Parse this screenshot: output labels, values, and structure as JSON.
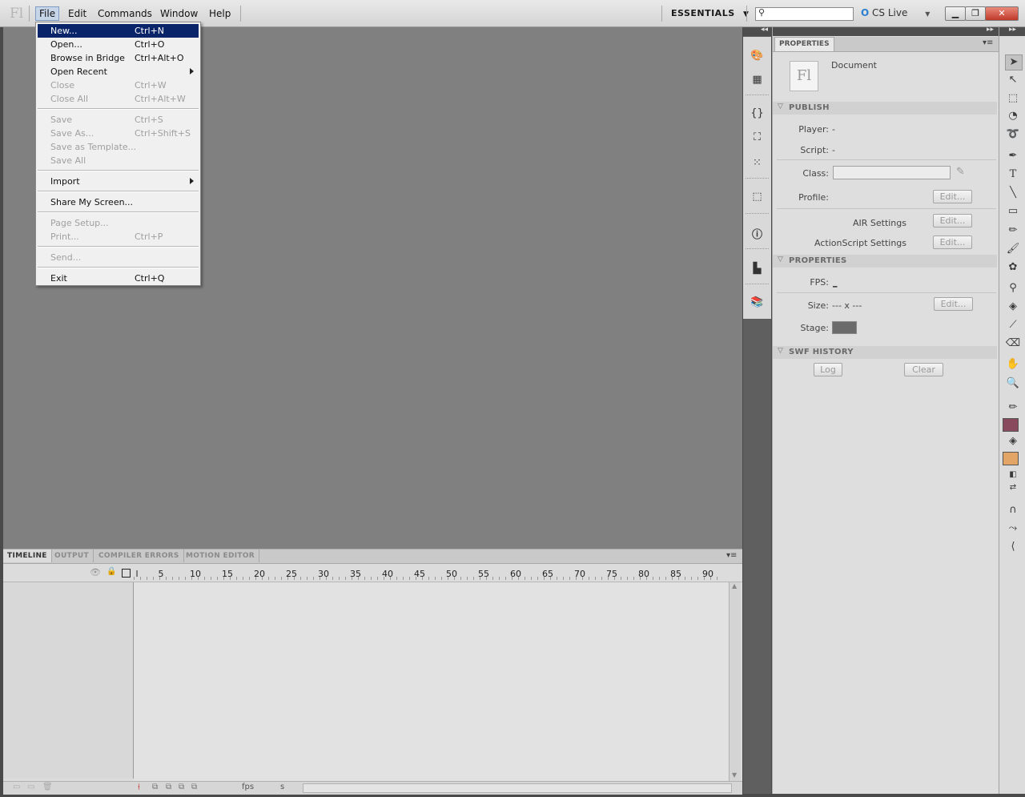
{
  "app": {
    "logo": "Fl",
    "menus": [
      "File",
      "Edit",
      "Commands",
      "Window",
      "Help"
    ],
    "workspace": "ESSENTIALS",
    "search_placeholder": "",
    "cs_live": "CS Live"
  },
  "file_menu": {
    "items": [
      {
        "label": "New...",
        "shortcut": "Ctrl+N",
        "enabled": true,
        "selected": true
      },
      {
        "label": "Open...",
        "shortcut": "Ctrl+O",
        "enabled": true
      },
      {
        "label": "Browse in Bridge",
        "shortcut": "Ctrl+Alt+O",
        "enabled": true
      },
      {
        "label": "Open Recent",
        "shortcut": "",
        "enabled": true,
        "submenu": true
      },
      {
        "label": "Close",
        "shortcut": "Ctrl+W",
        "enabled": false
      },
      {
        "label": "Close All",
        "shortcut": "Ctrl+Alt+W",
        "enabled": false
      },
      {
        "label": "Save",
        "shortcut": "Ctrl+S",
        "enabled": false
      },
      {
        "label": "Save As...",
        "shortcut": "Ctrl+Shift+S",
        "enabled": false
      },
      {
        "label": "Save as Template...",
        "shortcut": "",
        "enabled": false
      },
      {
        "label": "Save All",
        "shortcut": "",
        "enabled": false
      },
      {
        "label": "Import",
        "shortcut": "",
        "enabled": true,
        "submenu": true
      },
      {
        "label": "Share My Screen...",
        "shortcut": "",
        "enabled": true
      },
      {
        "label": "Page Setup...",
        "shortcut": "",
        "enabled": false
      },
      {
        "label": "Print...",
        "shortcut": "Ctrl+P",
        "enabled": false
      },
      {
        "label": "Send...",
        "shortcut": "",
        "enabled": false
      },
      {
        "label": "Exit",
        "shortcut": "Ctrl+Q",
        "enabled": true
      }
    ]
  },
  "timeline": {
    "tabs": [
      "TIMELINE",
      "OUTPUT",
      "COMPILER ERRORS",
      "MOTION EDITOR"
    ],
    "ruler": [
      "l",
      "5",
      "10",
      "15",
      "20",
      "25",
      "30",
      "35",
      "40",
      "45",
      "50",
      "55",
      "60",
      "65",
      "70",
      "75",
      "80",
      "85",
      "90"
    ],
    "footer_fps": "fps",
    "footer_s": "s"
  },
  "properties": {
    "tab": "PROPERTIES",
    "doc_icon": "Fl",
    "doc_type": "Document",
    "publish": {
      "title": "PUBLISH",
      "player_label": "Player:",
      "player_value": "-",
      "script_label": "Script:",
      "script_value": "-",
      "class_label": "Class:",
      "class_value": "",
      "profile_label": "Profile:",
      "profile_button": "Edit...",
      "air_label": "AIR Settings",
      "air_button": "Edit...",
      "as_label": "ActionScript Settings",
      "as_button": "Edit..."
    },
    "props": {
      "title": "PROPERTIES",
      "fps_label": "FPS:",
      "fps_value": "_",
      "size_label": "Size:",
      "size_value": "--- x ---",
      "size_button": "Edit...",
      "stage_label": "Stage:",
      "stage_color": "#6b6b6b"
    },
    "swf_history": {
      "title": "SWF HISTORY",
      "log_button": "Log",
      "clear_button": "Clear"
    }
  },
  "tools": {
    "stroke_color": "#8a4a5e",
    "fill_color": "#e2a566"
  }
}
